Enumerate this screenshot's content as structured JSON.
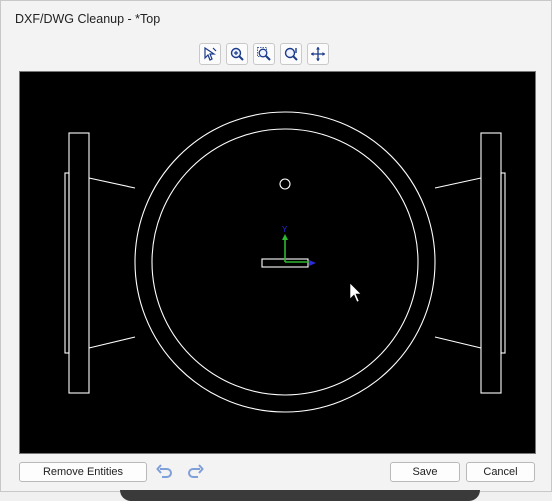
{
  "window": {
    "title": "DXF/DWG Cleanup - *Top"
  },
  "toolbar": {
    "tools": [
      {
        "icon": "select-arrow-icon",
        "name": "select-tool-button"
      },
      {
        "icon": "zoom-in-icon",
        "name": "zoom-tool-button"
      },
      {
        "icon": "zoom-window-icon",
        "name": "zoom-window-button"
      },
      {
        "icon": "zoom-fit-icon",
        "name": "zoom-fit-button"
      },
      {
        "icon": "pan-move-icon",
        "name": "pan-button"
      }
    ]
  },
  "axes": {
    "y_label": "Y"
  },
  "buttons": {
    "remove_entities": "Remove Entities",
    "save": "Save",
    "cancel": "Cancel"
  },
  "colors": {
    "canvas": "#000000",
    "drawing": "#ffffff",
    "axis_y": "#2fb82f",
    "axis_x": "#2b2bdb"
  }
}
